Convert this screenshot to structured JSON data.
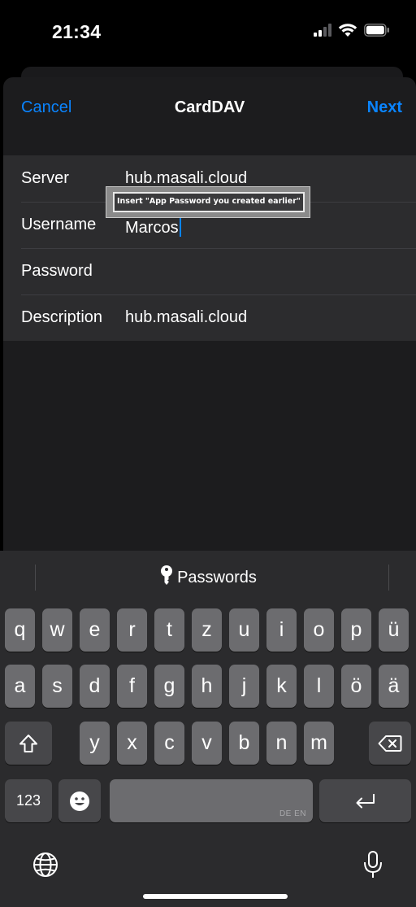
{
  "status_bar": {
    "time": "21:34"
  },
  "nav": {
    "cancel_label": "Cancel",
    "title": "CardDAV",
    "next_label": "Next"
  },
  "form": {
    "server": {
      "label": "Server",
      "value": "hub.masali.cloud"
    },
    "username": {
      "label": "Username",
      "value": "Marcos"
    },
    "password": {
      "label": "Password",
      "value": ""
    },
    "description": {
      "label": "Description",
      "value": "hub.masali.cloud"
    }
  },
  "annotation": {
    "text": "Insert \"App Password you created earlier\""
  },
  "keyboard": {
    "suggestion": "Passwords",
    "row1": [
      "q",
      "w",
      "e",
      "r",
      "t",
      "z",
      "u",
      "i",
      "o",
      "p",
      "ü"
    ],
    "row2": [
      "a",
      "s",
      "d",
      "f",
      "g",
      "h",
      "j",
      "k",
      "l",
      "ö",
      "ä"
    ],
    "row3": [
      "y",
      "x",
      "c",
      "v",
      "b",
      "n",
      "m"
    ],
    "numbers_label": "123",
    "space_lang": "DE EN"
  },
  "colors": {
    "accent": "#0a84ff",
    "sheet": "#1c1c1e",
    "cell": "#2c2c2e",
    "key": "#6c6c6f",
    "key_dark": "#47474a"
  },
  "icons": {
    "signal": "cellular-signal-icon",
    "wifi": "wifi-icon",
    "battery": "battery-icon",
    "key": "key-icon",
    "shift": "shift-icon",
    "delete": "delete-icon",
    "emoji": "emoji-icon",
    "return": "return-icon",
    "globe": "globe-icon",
    "mic": "microphone-icon"
  }
}
